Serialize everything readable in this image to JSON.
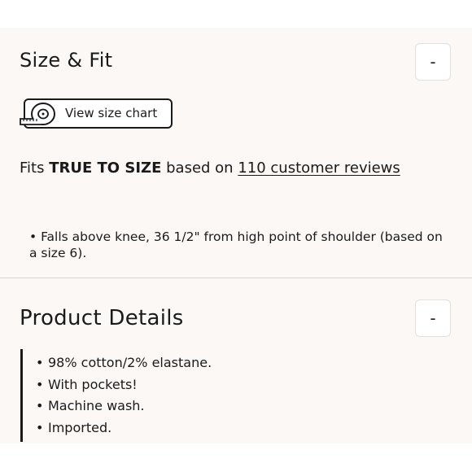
{
  "size_fit": {
    "title": "Size & Fit",
    "toggle": "-",
    "size_chart_label": "View size chart",
    "fit_prefix": "Fits ",
    "fit_emphasis": "TRUE TO SIZE",
    "fit_middle": " based on ",
    "fit_link": "110 customer reviews",
    "note": "•  Falls above knee, 36 1/2\" from high point of shoulder (based on a size 6)."
  },
  "product_details": {
    "title": "Product Details",
    "toggle": "-",
    "items": [
      "98% cotton/2% elastane.",
      "With pockets!",
      "Machine wash.",
      "Imported."
    ]
  },
  "icons": {
    "size_chart_icon": "measuring-tape-icon"
  }
}
